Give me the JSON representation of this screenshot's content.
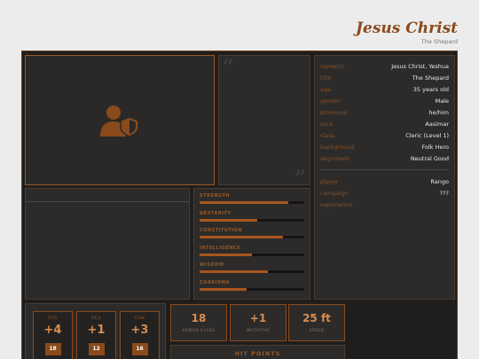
{
  "header": {
    "name": "Jesus Christ",
    "subtitle": "The Shepard"
  },
  "portrait": {
    "icon": "user-shield-icon"
  },
  "quote": {
    "open": "“",
    "close": "”"
  },
  "info": {
    "rows": [
      {
        "label": "name(s)",
        "value": "Jesus Christ, Yeshua"
      },
      {
        "label": "title",
        "value": "The Shepard"
      },
      {
        "label": "age",
        "value": "35 years old"
      },
      {
        "label": "gender",
        "value": "Male"
      },
      {
        "label": "pronouns",
        "value": "he/him"
      },
      {
        "label": "race",
        "value": "Aasimar"
      },
      {
        "label": "class",
        "value": "Cleric (Level 1)"
      },
      {
        "label": "background",
        "value": "Folk Hero"
      },
      {
        "label": "alignment",
        "value": "Neutral Good"
      }
    ],
    "player_rows": [
      {
        "label": "player",
        "value": "Rango"
      },
      {
        "label": "campaign",
        "value": "???"
      },
      {
        "label": "experience",
        "value": ""
      }
    ]
  },
  "attributes": [
    {
      "label": "STRENGTH",
      "percent": 85
    },
    {
      "label": "DEXTERITY",
      "percent": 55
    },
    {
      "label": "CONSTITUTION",
      "percent": 80
    },
    {
      "label": "INTELLIGENCE",
      "percent": 50
    },
    {
      "label": "WISDOM",
      "percent": 65
    },
    {
      "label": "CHARISMA",
      "percent": 45
    }
  ],
  "scores": [
    {
      "label": "STR",
      "modifier": "+4",
      "value": "18"
    },
    {
      "label": "DEX",
      "modifier": "+1",
      "value": "12"
    },
    {
      "label": "CON",
      "modifier": "+3",
      "value": "16"
    }
  ],
  "stats": [
    {
      "value": "18",
      "label": "ARMOR CLASS"
    },
    {
      "value": "+1",
      "label": "INITIATIVE"
    },
    {
      "value": "25 ft",
      "label": "SPEED"
    }
  ],
  "hp": {
    "label": "HIT POINTS"
  },
  "colors": {
    "accent": "#8a4a1c",
    "background": "#1f1e1d",
    "panel": "#2c2b2a"
  }
}
